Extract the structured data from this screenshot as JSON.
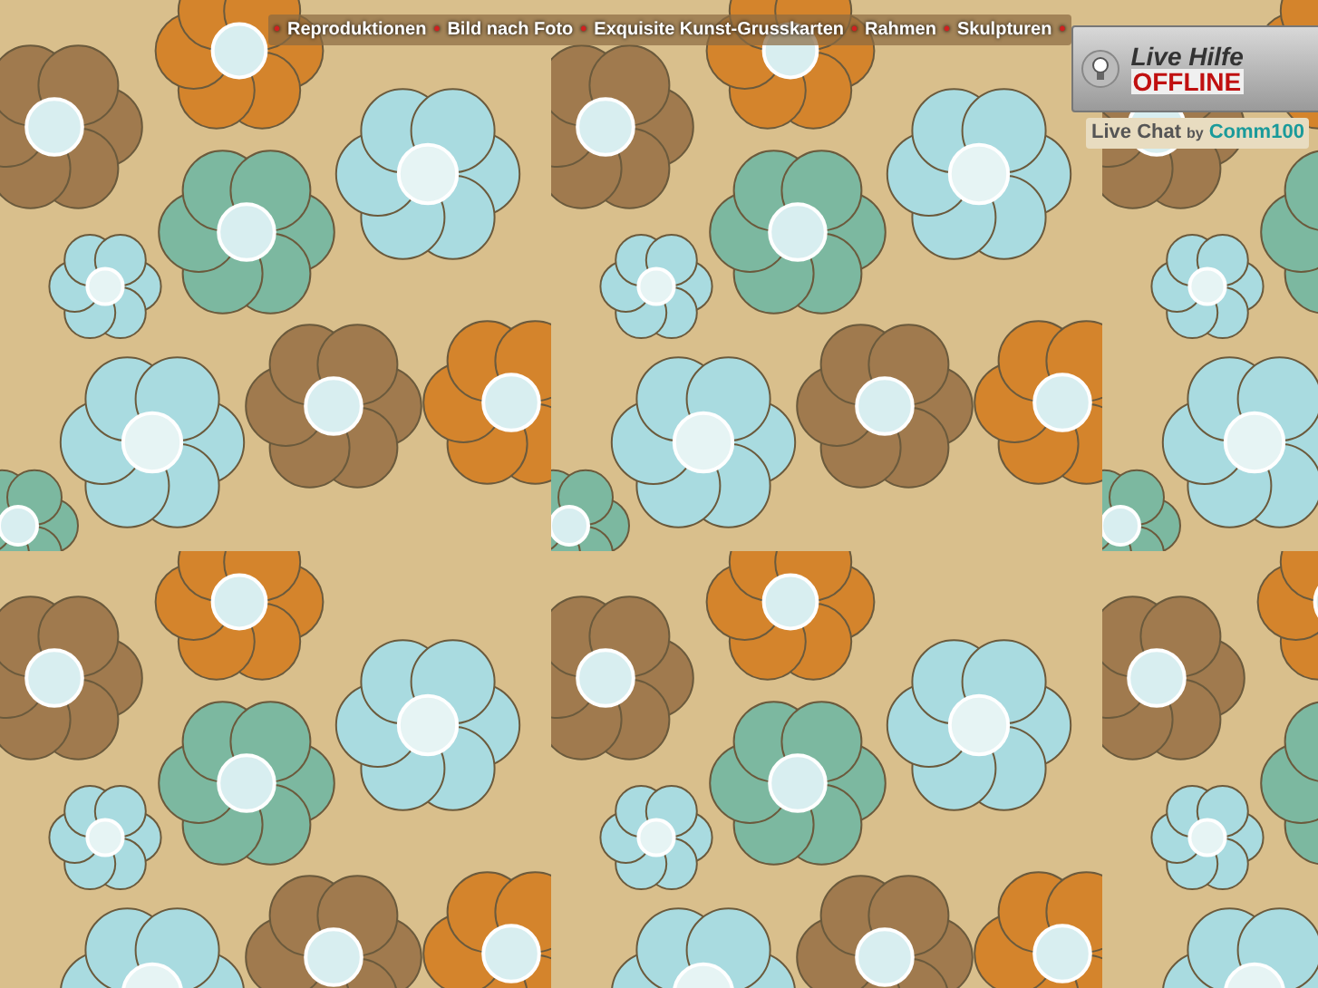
{
  "nav": {
    "separator": "•",
    "links": [
      "Reproduktionen",
      "Bild nach Foto",
      "Exquisite Kunst-Grusskarten",
      "Rahmen",
      "Skulpturen"
    ]
  },
  "live_help": {
    "title": "Live Hilfe",
    "status": "OFFLINE",
    "online": false,
    "chat_label": "Live Chat",
    "by": "by",
    "provider": "Comm100"
  }
}
